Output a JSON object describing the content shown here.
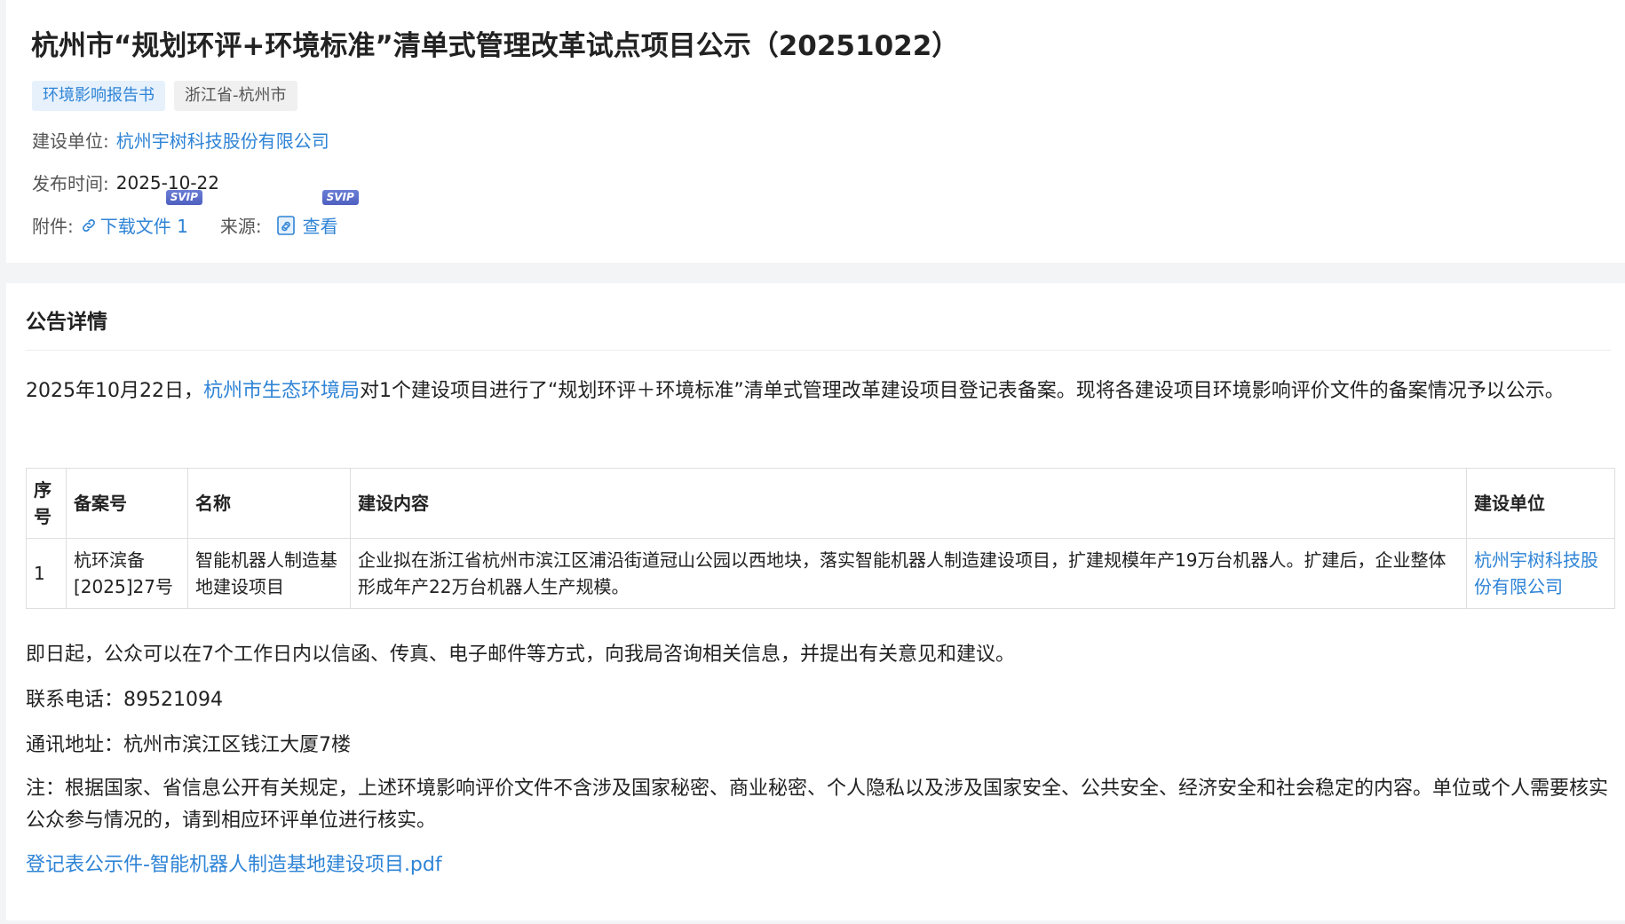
{
  "header": {
    "title": "杭州市“规划环评+环境标准”清单式管理改革试点项目公示（20251022）",
    "tags": [
      "环境影响报告书",
      "浙江省-杭州市"
    ],
    "unit_label": "建设单位:",
    "unit_value": "杭州宇树科技股份有限公司",
    "date_label": "发布时间:",
    "date_value": "2025-10-22",
    "attach_label": "附件:",
    "attach_link": "下载文件 1",
    "source_label": "来源:",
    "source_link": "查看",
    "svip_badge": "SVIP"
  },
  "detail": {
    "section_title": "公告详情",
    "intro_before": "2025年10月22日，",
    "intro_link": "杭州市生态环境局",
    "intro_after": "对1个建设项目进行了“规划环评＋环境标准”清单式管理改革建设项目登记表备案。现将各建设项目环境影响评价文件的备案情况予以公示。",
    "table": {
      "headers": [
        "序号",
        "备案号",
        "名称",
        "建设内容",
        "建设单位"
      ],
      "rows": [
        [
          "1",
          "杭环滨备[2025]27号",
          "智能机器人制造基地建设项目",
          "企业拟在浙江省杭州市滨江区浦沿街道冠山公园以西地块，落实智能机器人制造建设项目，扩建规模年产19万台机器人。扩建后，企业整体形成年产22万台机器人生产规模。",
          "杭州宇树科技股份有限公司"
        ]
      ]
    },
    "notice": "即日起，公众可以在7个工作日内以信函、传真、电子邮件等方式，向我局咨询相关信息，并提出有关意见和建议。",
    "phone": "联系电话：89521094",
    "address": "通讯地址：杭州市滨江区钱江大厦7楼",
    "note": "注：根据国家、省信息公开有关规定，上述环境影响评价文件不含涉及国家秘密、商业秘密、个人隐私以及涉及国家安全、公共安全、经济安全和社会稳定的内容。单位或个人需要核实公众参与情况的，请到相应环评单位进行核实。",
    "file_link": "登记表公示件-智能机器人制造基地建设项目.pdf"
  },
  "colors": {
    "accent": "#2f84d6",
    "tag_type_bg": "#e6f1fc",
    "tag_region_bg": "#f0f0f0",
    "svip": "#5566c8"
  },
  "icons": {
    "attach": "link-icon",
    "source": "document-link-icon"
  }
}
